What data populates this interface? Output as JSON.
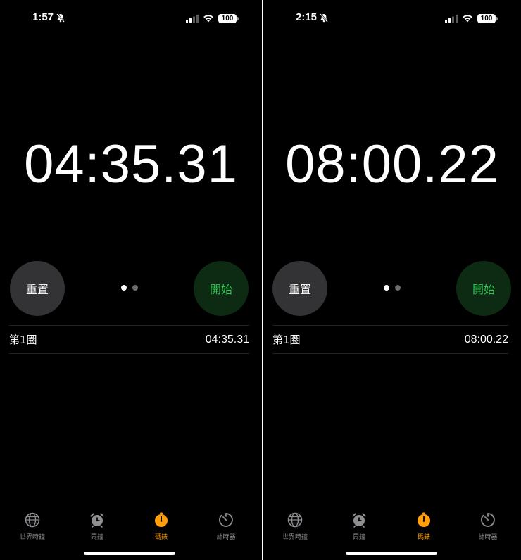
{
  "screens": [
    {
      "status": {
        "time": "1:57",
        "battery": "100"
      },
      "timer": "04:35.31",
      "buttons": {
        "reset": "重置",
        "start": "開始"
      },
      "laps": [
        {
          "label": "第1圈",
          "time": "04:35.31"
        }
      ],
      "tabs": [
        {
          "label": "世界時鐘",
          "icon": "globe-icon"
        },
        {
          "label": "鬧鐘",
          "icon": "alarm-clock-icon"
        },
        {
          "label": "碼錶",
          "icon": "stopwatch-icon",
          "active": true
        },
        {
          "label": "計時器",
          "icon": "timer-icon"
        }
      ]
    },
    {
      "status": {
        "time": "2:15",
        "battery": "100"
      },
      "timer": "08:00.22",
      "buttons": {
        "reset": "重置",
        "start": "開始"
      },
      "laps": [
        {
          "label": "第1圈",
          "time": "08:00.22"
        }
      ],
      "tabs": [
        {
          "label": "世界時鐘",
          "icon": "globe-icon"
        },
        {
          "label": "鬧鐘",
          "icon": "alarm-clock-icon"
        },
        {
          "label": "碼錶",
          "icon": "stopwatch-icon",
          "active": true
        },
        {
          "label": "計時器",
          "icon": "timer-icon"
        }
      ]
    }
  ],
  "colors": {
    "background": "#000000",
    "active_tab": "#ff9f0a",
    "start_text": "#34c759",
    "start_bg": "#0d2b12",
    "reset_bg": "#333335"
  }
}
